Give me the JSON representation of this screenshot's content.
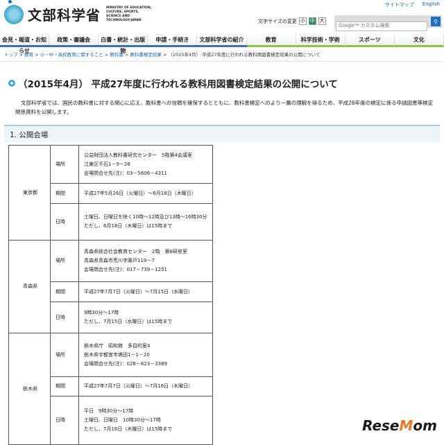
{
  "header": {
    "logo_text": "文部科学省",
    "logo_en": "MINISTRY OF EDUCATION, CULTURE, SPORTS, SCIENCE AND TECHNOLOGY-JAPAN",
    "links": [
      "サイトマップ",
      "English"
    ],
    "font_size_label": "文字サイズの変更",
    "font_sizes": [
      "小",
      "中",
      "大"
    ],
    "search_placeholder": "Google™ カスタム検索"
  },
  "nav": [
    "会見・報道・お知らせ",
    "政策・審議会",
    "白書・統計・出版物",
    "申請・手続き",
    "文部科学省の紹介",
    "教育",
    "科学技術・学術",
    "スポーツ",
    "文化"
  ],
  "breadcrumb": [
    "トップ",
    "教育",
    "小・中・高校教育に関すること",
    "教科書",
    "教科書検定結果"
  ],
  "breadcrumb_current": "（2015年4月） 平成27年度に行われる教科用図書検定結果の公開について",
  "title": "（2015年4月） 平成27年度に行われる教科用図書検定結果の公開について",
  "intro": "文部科学省では、国民の教科書に対する関心に応え、教科書への信頼を確保するとともに、教科書検定へのより一層の理解を得るため、平成26年度の検定に係る申請図書等検定関係資料を公開します。",
  "section": "1. 公開会場",
  "venues": [
    {
      "pref": "東京都",
      "rows": [
        {
          "k": "場所",
          "v": [
            "公益財団法人教科書研究センター　5階第4会議室",
            "江東区千石1－9－28",
            "会場問合せ先(注)：03－5606－4311"
          ]
        },
        {
          "k": "期間",
          "v": [
            "平成27年5月26日（火曜日）～6月18日（木曜日）"
          ]
        },
        {
          "k": "日時",
          "v": [
            "土曜日、日曜日を除く10時～12時及び13時～16時30分",
            "ただし、6月18日（木曜日）は15時まで"
          ]
        }
      ]
    },
    {
      "pref": "青森県",
      "rows": [
        {
          "k": "場所",
          "v": [
            "青森県総合社会教育センター　2階　第8研修室",
            "青森県青森市荒川字藤戸119－7",
            "会場問合せ先(注)：017－739－1251"
          ]
        },
        {
          "k": "期間",
          "v": [
            "平成27年7月7日（火曜日）～7月15日（水曜日）"
          ]
        },
        {
          "k": "日時",
          "v": [
            "9時30分～17時",
            "ただし、7月15日（水曜日）は15時まで"
          ]
        }
      ]
    },
    {
      "pref": "栃木県",
      "rows": [
        {
          "k": "場所",
          "v": [
            "栃木県庁　昭和館　多目的室4",
            "栃木県宇都宮市塙田1－1－20",
            "会場問合せ先(注)：028－623－3389"
          ]
        },
        {
          "k": "期間",
          "v": [
            "平成27年7月7日（火曜日）～7月16日（木曜日）"
          ]
        },
        {
          "k": "日時",
          "v": [
            "平日　9時30分～17時",
            "土曜日、日曜日　10時30分～17時",
            "ただし、7月16日（木曜日）は15時まで"
          ]
        }
      ]
    }
  ],
  "watermark": "ReseMom"
}
